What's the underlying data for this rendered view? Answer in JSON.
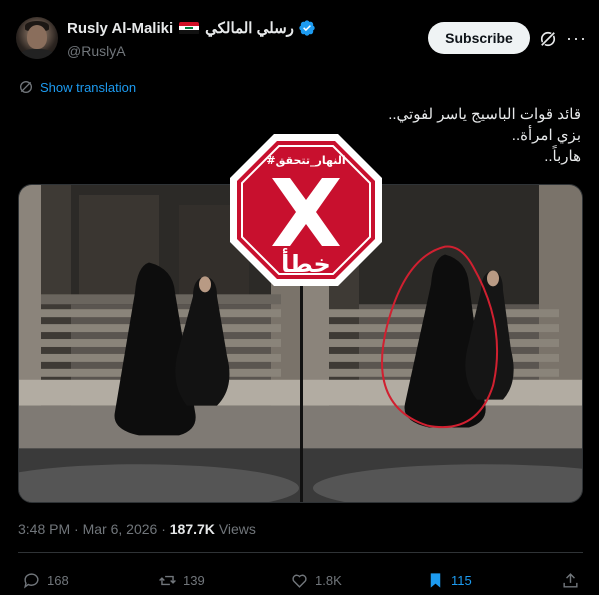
{
  "author": {
    "display_name": "Rusly Al-Maliki",
    "arabic_name": "رسلي المالكي",
    "handle": "@RuslyA",
    "verified_icon": "verified-badge-icon",
    "flag": "iraq-flag-icon"
  },
  "header": {
    "subscribe_label": "Subscribe"
  },
  "translate": {
    "label": "Show translation"
  },
  "tweet": {
    "line1": "قائد قوات الباسيج ياسر لفوتي..",
    "line2": "بزي امرأة..",
    "line3": "هارباً.."
  },
  "stamp": {
    "hashtag": "#النهار_تتحقق",
    "verdict": "خطأ",
    "color": "#c8102e"
  },
  "meta": {
    "time": "3:48 PM",
    "date": "Mar 6, 2026",
    "views_count": "187.7K",
    "views_label": "Views"
  },
  "actions": {
    "replies": "168",
    "reposts": "139",
    "likes": "1.8K",
    "bookmarks": "115"
  },
  "colors": {
    "accent": "#1d9bf0",
    "text": "#e7e9ea",
    "muted": "#71767b",
    "background": "#000000"
  }
}
